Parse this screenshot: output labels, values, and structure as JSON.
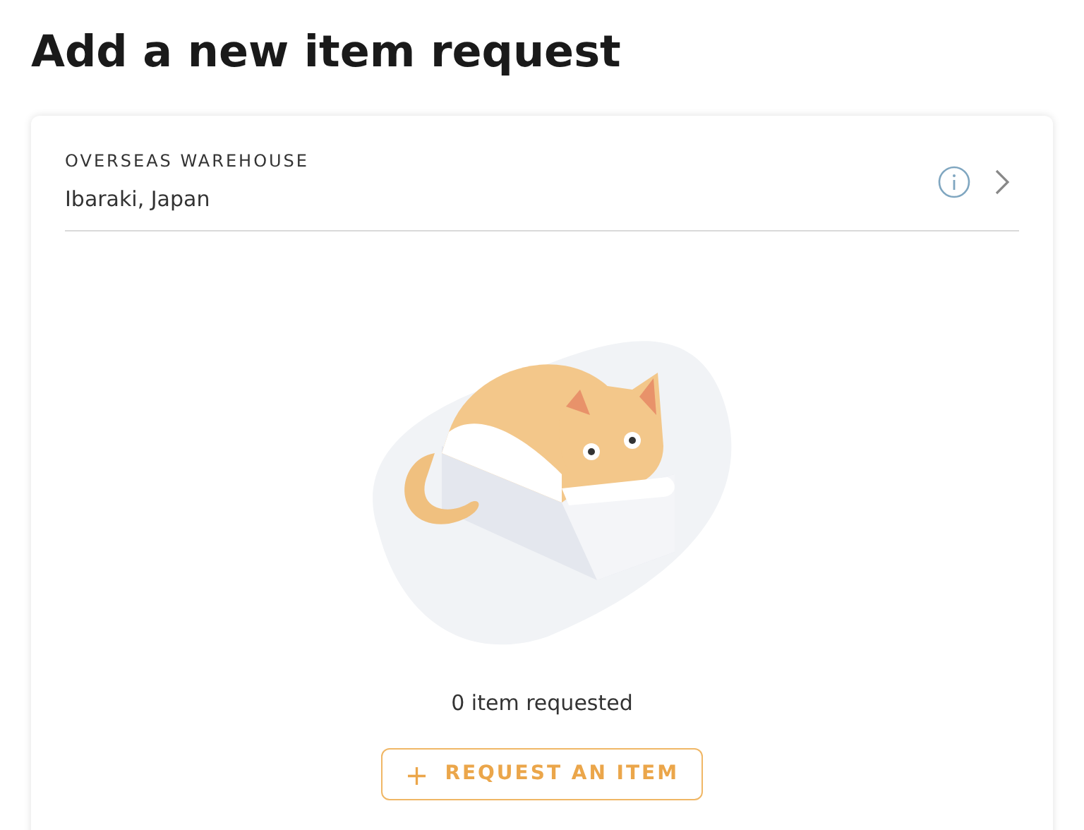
{
  "page": {
    "title": "Add a new item request"
  },
  "warehouse": {
    "label": "OVERSEAS WAREHOUSE",
    "value": "Ibaraki, Japan"
  },
  "empty_state": {
    "message": "0 item requested"
  },
  "request_button": {
    "icon_text": "+",
    "label": "REQUEST AN ITEM"
  }
}
